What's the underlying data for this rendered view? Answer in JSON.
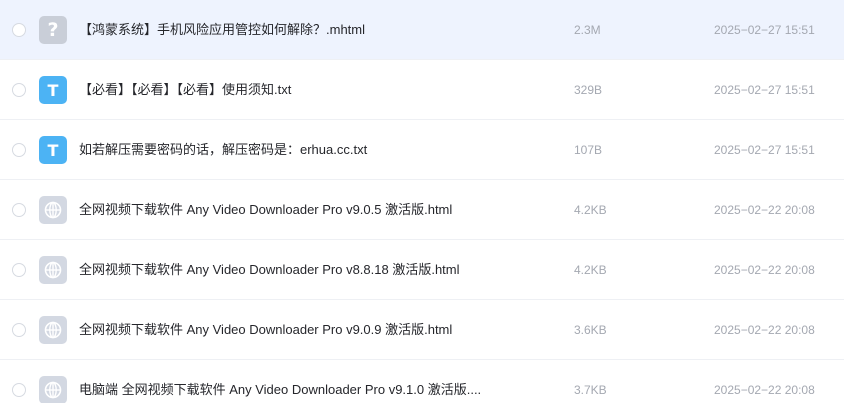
{
  "files": [
    {
      "icon": "unknown-file-icon",
      "icon_glyph": "?",
      "name": "【鸿蒙系统】手机风险应用管控如何解除？.mhtml",
      "size": "2.3M",
      "date": "2025−02−27 15:51",
      "selected": true
    },
    {
      "icon": "text-file-icon",
      "icon_glyph": "T",
      "name": "【必看】【必看】【必看】使用须知.txt",
      "size": "329B",
      "date": "2025−02−27 15:51",
      "selected": false
    },
    {
      "icon": "text-file-icon",
      "icon_glyph": "T",
      "name": "如若解压需要密码的话，解压密码是：erhua.cc.txt",
      "size": "107B",
      "date": "2025−02−27 15:51",
      "selected": false
    },
    {
      "icon": "html-file-icon",
      "icon_glyph": "",
      "name": "全网视频下载软件 Any Video Downloader Pro v9.0.5 激活版.html",
      "size": "4.2KB",
      "date": "2025−02−22 20:08",
      "selected": false
    },
    {
      "icon": "html-file-icon",
      "icon_glyph": "",
      "name": "全网视频下载软件 Any Video Downloader Pro v8.8.18 激活版.html",
      "size": "4.2KB",
      "date": "2025−02−22 20:08",
      "selected": false
    },
    {
      "icon": "html-file-icon",
      "icon_glyph": "",
      "name": "全网视频下载软件 Any Video Downloader Pro v9.0.9 激活版.html",
      "size": "3.6KB",
      "date": "2025−02−22 20:08",
      "selected": false
    },
    {
      "icon": "html-file-icon",
      "icon_glyph": "",
      "name": "电脑端 全网视频下载软件 Any Video Downloader Pro v9.1.0 激活版....",
      "size": "3.7KB",
      "date": "2025−02−22 20:08",
      "selected": false
    }
  ]
}
